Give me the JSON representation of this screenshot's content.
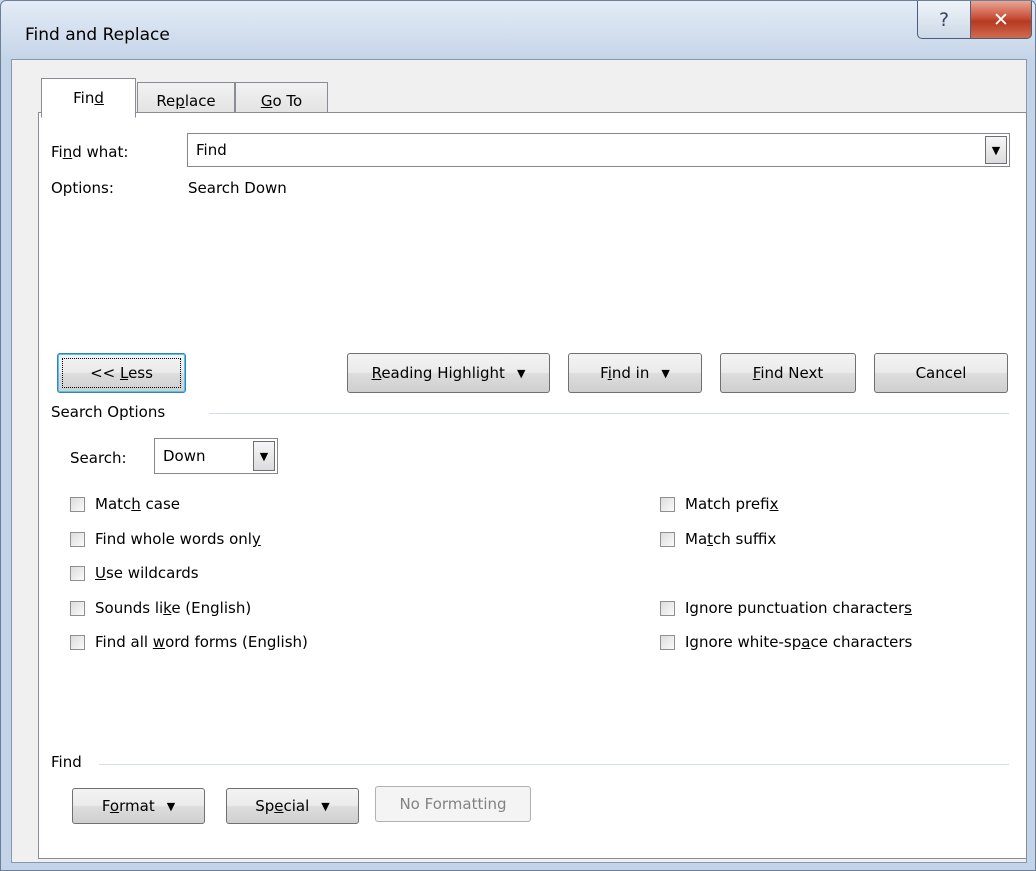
{
  "window": {
    "title": "Find and Replace",
    "help_icon_glyph": "?",
    "close_icon_glyph": "✕"
  },
  "tabs": [
    {
      "label": "Find",
      "mnemonic_index": 3,
      "active": true
    },
    {
      "label": "Replace",
      "mnemonic_index": 2,
      "active": false
    },
    {
      "label": "Go To",
      "mnemonic_index": 0,
      "active": false
    }
  ],
  "find_what": {
    "label": "Find what:",
    "label_mnemonic_index": 2,
    "value": "Find"
  },
  "options": {
    "label": "Options:",
    "value": "Search Down"
  },
  "buttons": {
    "less": {
      "label": "<< Less",
      "mnemonic_index": 3
    },
    "reading_highlight": {
      "label": "Reading Highlight",
      "mnemonic_index": 0
    },
    "find_in": {
      "label": "Find in",
      "mnemonic_index": 1
    },
    "find_next": {
      "label": "Find Next",
      "mnemonic_index": 0
    },
    "cancel": {
      "label": "Cancel"
    }
  },
  "search_options": {
    "group_label": "Search Options",
    "search_label": "Search:",
    "search_value": "Down",
    "left_checkboxes": [
      {
        "label": "Match case",
        "mnemonic_index": 4,
        "checked": false
      },
      {
        "label": "Find whole words only",
        "mnemonic_index": 20,
        "checked": false
      },
      {
        "label": "Use wildcards",
        "mnemonic_index": 0,
        "checked": false
      },
      {
        "label": "Sounds like (English)",
        "mnemonic_index": 9,
        "checked": false
      },
      {
        "label": "Find all word forms (English)",
        "mnemonic_index": 9,
        "checked": false
      }
    ],
    "right_checkboxes": [
      {
        "label": "Match prefix",
        "mnemonic_index": 11,
        "checked": false
      },
      {
        "label": "Match suffix",
        "mnemonic_index": 2,
        "checked": false
      },
      {
        "label": "Ignore punctuation characters",
        "mnemonic_index": 28,
        "checked": false
      },
      {
        "label": "Ignore white-space characters",
        "mnemonic_index": 15,
        "checked": false
      }
    ]
  },
  "find_group": {
    "group_label": "Find",
    "format": {
      "label": "Format",
      "mnemonic_index": 1
    },
    "special": {
      "label": "Special",
      "mnemonic_index": 2
    },
    "no_formatting": {
      "label": "No Formatting",
      "enabled": false
    }
  },
  "colors": {
    "close_button": "#c9503a",
    "dialog_bg": "#f0f0f0",
    "tab_panel_bg": "#ffffff",
    "default_button_border": "#3c7fb1",
    "disabled_text": "#838383"
  }
}
